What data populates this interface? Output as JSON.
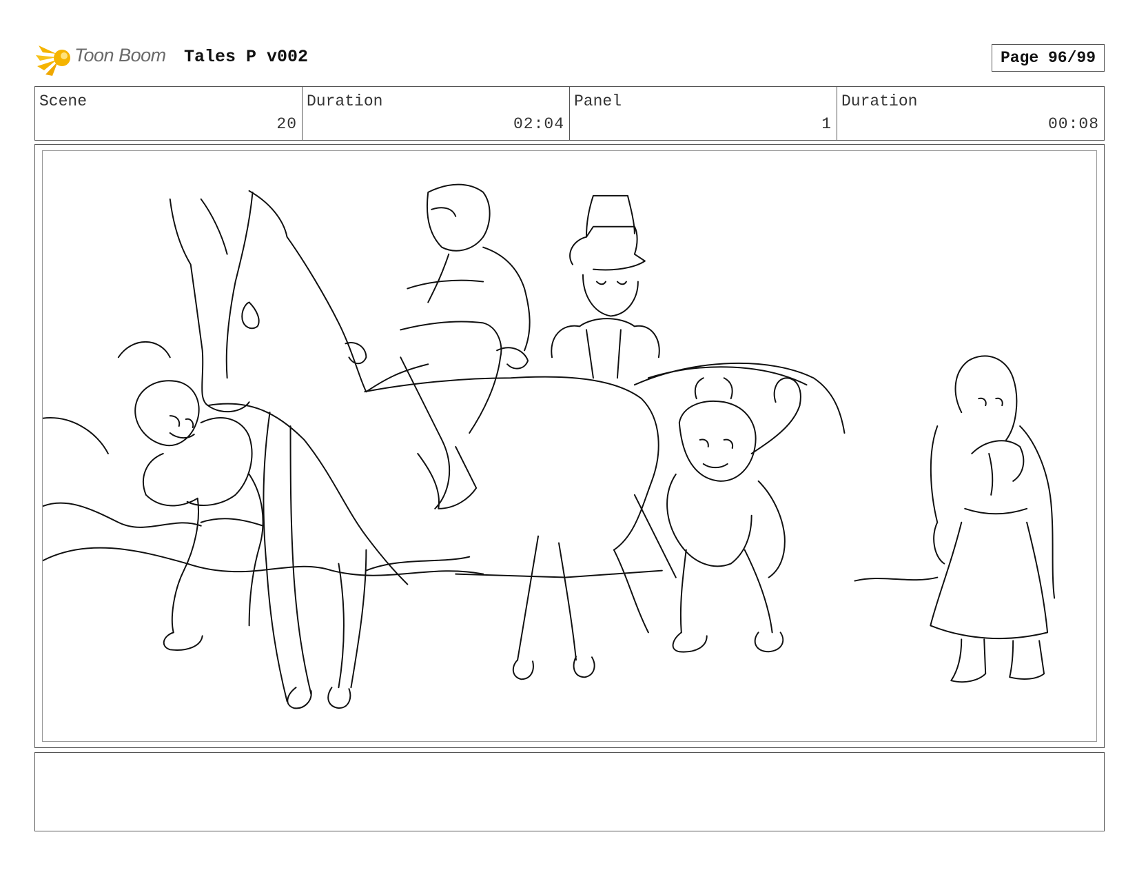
{
  "header": {
    "logo_text": "Toon Boom",
    "project_title": "Tales P v002",
    "page_label": "Page 96/99"
  },
  "info": [
    {
      "label": "Scene",
      "value": "20"
    },
    {
      "label": "Duration",
      "value": "02:04"
    },
    {
      "label": "Panel",
      "value": "1"
    },
    {
      "label": "Duration",
      "value": "00:08"
    }
  ],
  "panel": {
    "notes": ""
  },
  "colors": {
    "logo_accent": "#f5b400",
    "frame": "#555555",
    "sketch_line": "#111111"
  },
  "icons": [
    "toon-boom-logo-icon"
  ]
}
